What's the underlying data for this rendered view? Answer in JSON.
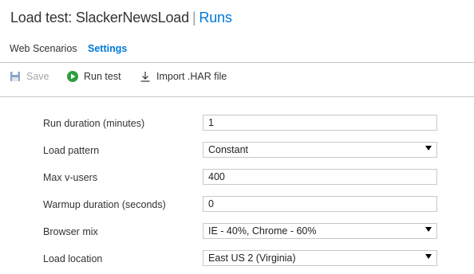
{
  "header": {
    "title": "Load test: SlackerNewsLoad",
    "separator": "|",
    "section": "Runs"
  },
  "tabs": [
    {
      "label": "Web Scenarios",
      "active": false
    },
    {
      "label": "Settings",
      "active": true
    }
  ],
  "toolbar": {
    "save_label": "Save",
    "run_label": "Run test",
    "import_label": "Import .HAR file"
  },
  "form": {
    "run_duration": {
      "label": "Run duration (minutes)",
      "value": "1"
    },
    "load_pattern": {
      "label": "Load pattern",
      "value": "Constant"
    },
    "max_vusers": {
      "label": "Max v-users",
      "value": "400"
    },
    "warmup_duration": {
      "label": "Warmup duration (seconds)",
      "value": "0"
    },
    "browser_mix": {
      "label": "Browser mix",
      "value": "IE - 40%, Chrome - 60%"
    },
    "load_location": {
      "label": "Load location",
      "value": "East US 2 (Virginia)"
    }
  },
  "colors": {
    "accent": "#0078d7",
    "run_icon": "#2e9e3e",
    "disabled": "#a6a6a6"
  },
  "icons": [
    "save-icon",
    "play-icon",
    "download-icon",
    "dropdown-caret-icon"
  ]
}
